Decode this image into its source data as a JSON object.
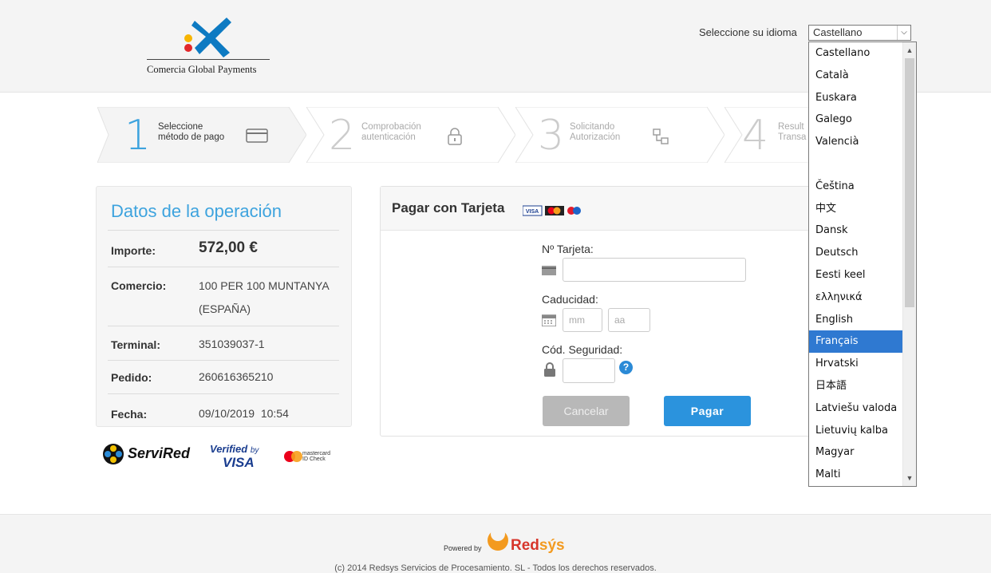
{
  "header": {
    "logo_text": "Comercia Global Payments",
    "language_label": "Seleccione su idioma",
    "language_selected": "Castellano",
    "language_options": [
      "Castellano",
      "Català",
      "Euskara",
      "Galego",
      "Valencià",
      "",
      "Čeština",
      "中文",
      "Dansk",
      "Deutsch",
      "Eesti keel",
      "ελληνικά",
      "English",
      "Français",
      "Hrvatski",
      "日本語",
      "Latviešu valoda",
      "Lietuvių kalba",
      "Magyar",
      "Malti"
    ],
    "language_highlighted_index": 13
  },
  "steps": [
    {
      "number": "1",
      "line1": "Seleccione",
      "line2": "método de pago",
      "active": true
    },
    {
      "number": "2",
      "line1": "Comprobación",
      "line2": "autenticación",
      "active": false
    },
    {
      "number": "3",
      "line1": "Solicitando",
      "line2": "Autorización",
      "active": false
    },
    {
      "number": "4",
      "line1": "Result",
      "line2": "Transa",
      "active": false
    }
  ],
  "operation": {
    "title": "Datos de la operación",
    "amount_label": "Importe:",
    "amount_value": "572,00 €",
    "merchant_label": "Comercio:",
    "merchant_value_1": "100 PER 100 MUNTANYA",
    "merchant_value_2": "(ESPAÑA)",
    "terminal_label": "Terminal:",
    "terminal_value": "351039037-1",
    "order_label": "Pedido:",
    "order_value": "260616365210",
    "date_label": "Fecha:",
    "date_value": "09/10/2019  10:54"
  },
  "brands": {
    "servired": "ServiRed",
    "verified_1": "Verified",
    "verified_by": "by",
    "verified_2": "VISA",
    "mastercard_1": "mastercard",
    "mastercard_2": "ID Check"
  },
  "payment": {
    "title": "Pagar con Tarjeta",
    "card_number_label": "Nº Tarjeta:",
    "card_number_value": "",
    "expiry_label": "Caducidad:",
    "month_placeholder": "mm",
    "year_placeholder": "aa",
    "cvv_label": "Cód. Seguridad:",
    "cvv_help": "?",
    "cancel_label": "Cancelar",
    "pay_label": "Pagar",
    "card_logos": {
      "visa": "VISA"
    }
  },
  "footer": {
    "powered_by": "Powered by",
    "brand_1": "Red",
    "brand_2": "sýs",
    "copyright": "(c) 2014 Redsys Servicios de Procesamiento. SL - Todos los derechos reservados."
  },
  "colors": {
    "accent": "#3da3de",
    "pay_button": "#2b93dd",
    "step_active": "#3da3de",
    "selected_option": "#2f79d1"
  }
}
